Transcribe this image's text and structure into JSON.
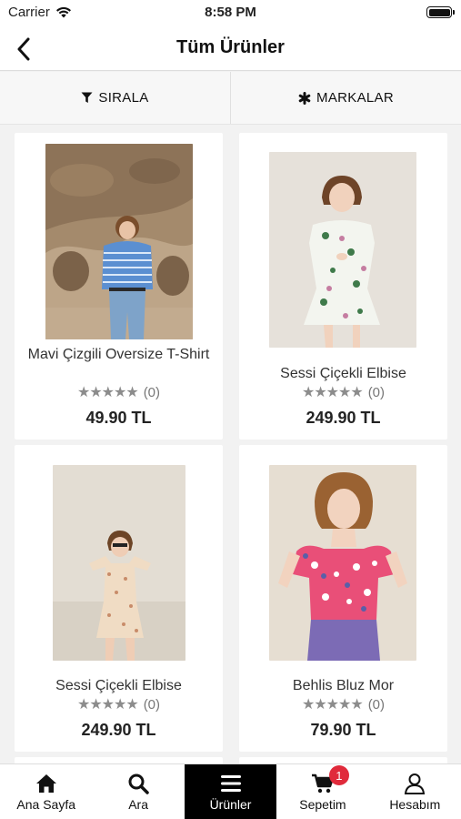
{
  "status_bar": {
    "carrier": "Carrier",
    "time": "8:58 PM"
  },
  "nav": {
    "title": "Tüm Ürünler"
  },
  "filters": {
    "sort_label": "SIRALA",
    "brands_label": "MARKALAR"
  },
  "products": [
    {
      "name": "Mavi Çizgili Oversize T-Shirt",
      "stars": "★★★★★",
      "review_count": "(0)",
      "price": "49.90 TL"
    },
    {
      "name": "Sessi Çiçekli Elbise",
      "stars": "★★★★★",
      "review_count": "(0)",
      "price": "249.90 TL"
    },
    {
      "name": "Sessi Çiçekli Elbise",
      "stars": "★★★★★",
      "review_count": "(0)",
      "price": "249.90 TL"
    },
    {
      "name": "Behlis Bluz Mor",
      "stars": "★★★★★",
      "review_count": "(0)",
      "price": "79.90 TL"
    }
  ],
  "tabs": [
    {
      "label": "Ana Sayfa",
      "icon": "home-icon"
    },
    {
      "label": "Ara",
      "icon": "search-icon"
    },
    {
      "label": "Ürünler",
      "icon": "menu-icon",
      "active": true
    },
    {
      "label": "Sepetim",
      "icon": "cart-icon",
      "badge": "1"
    },
    {
      "label": "Hesabım",
      "icon": "user-icon"
    }
  ],
  "colors": {
    "active_tab": "#000000",
    "badge": "#e02a3b",
    "star": "#8c8c8c"
  }
}
